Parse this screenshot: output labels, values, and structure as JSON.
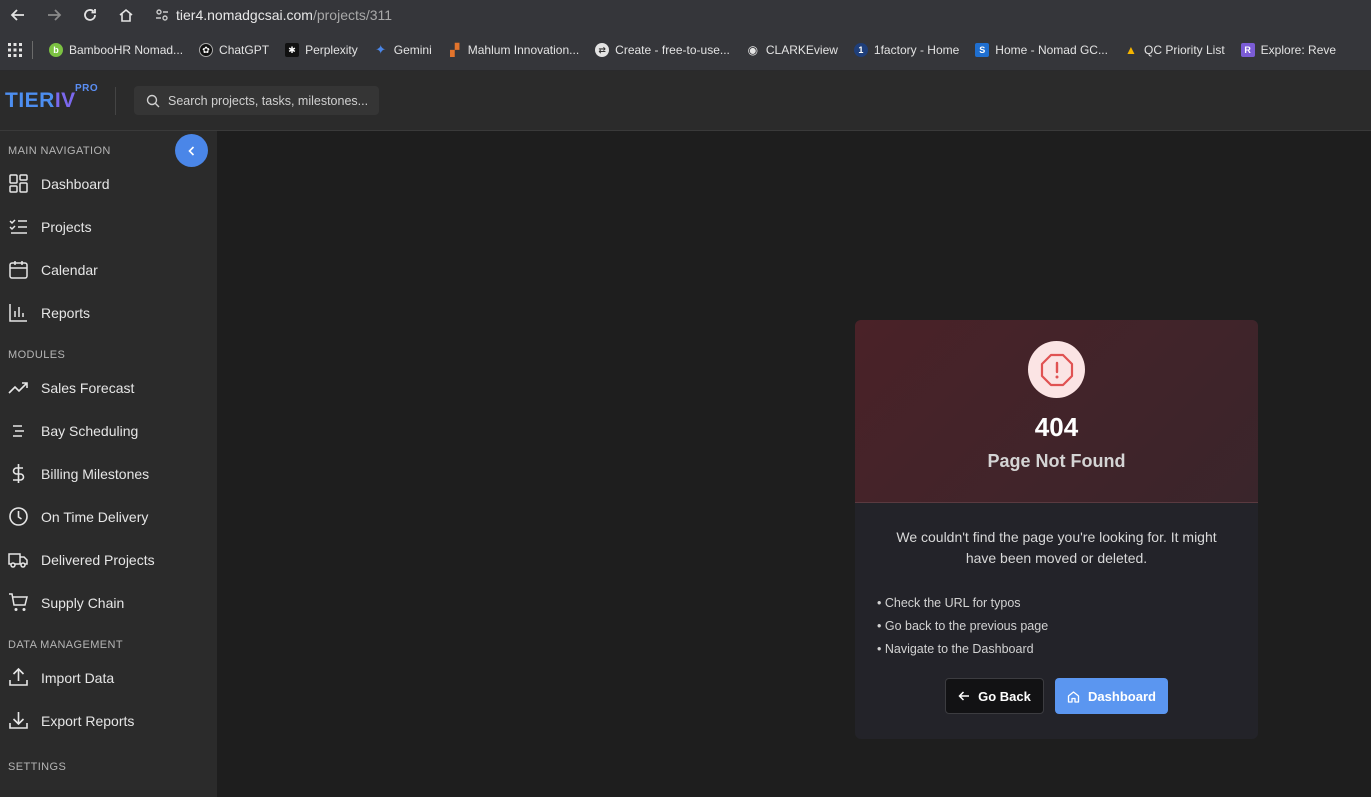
{
  "browser": {
    "url_host": "tier4.nomadgcsai.com",
    "url_path": "/projects/311",
    "bookmarks": [
      {
        "label": "BambooHR Nomad...",
        "icon": "bamboohr-icon",
        "color": "#7cc242"
      },
      {
        "label": "ChatGPT",
        "icon": "chatgpt-icon",
        "color": "#e3e3e3"
      },
      {
        "label": "Perplexity",
        "icon": "perplexity-icon",
        "color": "#e3e3e3"
      },
      {
        "label": "Gemini",
        "icon": "gemini-icon",
        "color": "#4a86e8"
      },
      {
        "label": "Mahlum Innovation...",
        "icon": "mahlum-icon",
        "color": "#e2742c"
      },
      {
        "label": "Create - free-to-use...",
        "icon": "create-icon",
        "color": "#e3e3e3"
      },
      {
        "label": "CLARKEview",
        "icon": "eye-icon",
        "color": "#e3e3e3"
      },
      {
        "label": "1factory - Home",
        "icon": "1factory-icon",
        "color": "#1f6fd0"
      },
      {
        "label": "Home - Nomad GC...",
        "icon": "sharepoint-icon",
        "color": "#1f6fd0"
      },
      {
        "label": "QC Priority List",
        "icon": "google-drive-icon",
        "color": "#f4b400"
      },
      {
        "label": "Explore: Reve",
        "icon": "reve-icon",
        "color": "#7b5cd6"
      }
    ]
  },
  "header": {
    "logo_tier": "TIER",
    "logo_iv": "IV",
    "logo_pro": "PRO",
    "search_placeholder": "Search projects, tasks, milestones..."
  },
  "sidebar": {
    "sections": {
      "main": "MAIN NAVIGATION",
      "modules": "MODULES",
      "data": "DATA MANAGEMENT",
      "settings": "SETTINGS"
    },
    "main_items": [
      "Dashboard",
      "Projects",
      "Calendar",
      "Reports"
    ],
    "module_items": [
      "Sales Forecast",
      "Bay Scheduling",
      "Billing Milestones",
      "On Time Delivery",
      "Delivered Projects",
      "Supply Chain"
    ],
    "data_items": [
      "Import Data",
      "Export Reports"
    ]
  },
  "error": {
    "code": "404",
    "title": "Page Not Found",
    "description": "We couldn't find the page you're looking for. It might have been moved or deleted.",
    "tips": [
      "• Check the URL for typos",
      "• Go back to the previous page",
      "• Navigate to the Dashboard"
    ],
    "back_label": "Go Back",
    "dashboard_label": "Dashboard"
  },
  "colors": {
    "accent": "#4a86e8",
    "error_red": "#e05252",
    "sidebar_bg": "#2b2b2b",
    "main_bg": "#1e1e1e"
  }
}
